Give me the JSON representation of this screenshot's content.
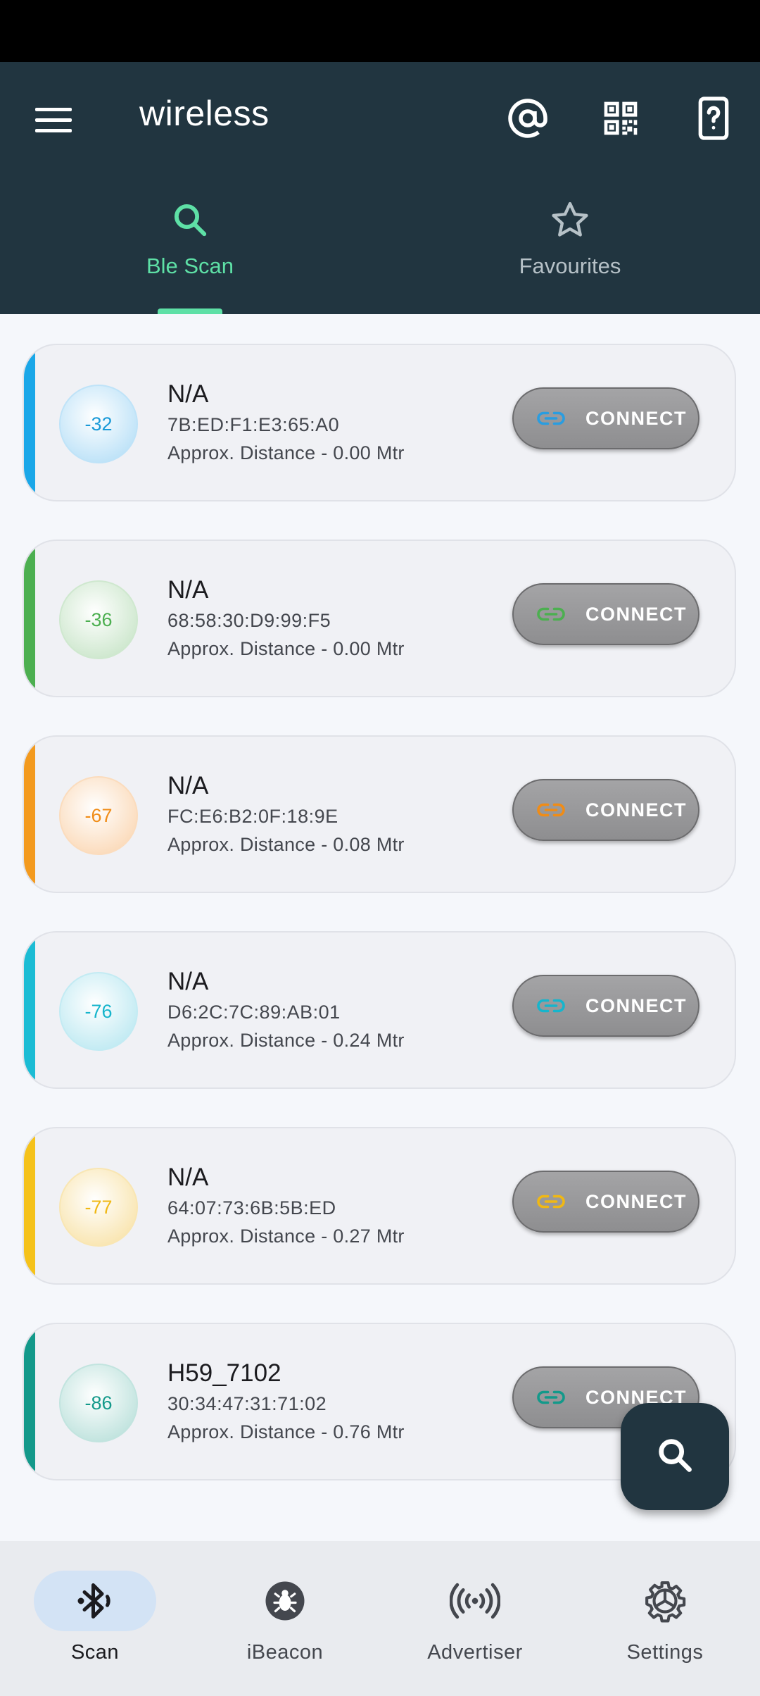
{
  "app_bar": {
    "title": "wireless",
    "menu_icon": "menu-icon",
    "actions": [
      "at-sign-icon",
      "qr-code-icon",
      "device-help-icon"
    ]
  },
  "tabs": [
    {
      "label": "Ble Scan",
      "icon": "search-icon",
      "active": true
    },
    {
      "label": "Favourites",
      "icon": "star-icon",
      "active": false
    }
  ],
  "devices": [
    {
      "rssi": "-32",
      "name": "N/A",
      "mac": "7B:ED:F1:E3:65:A0",
      "distance": "Approx. Distance -  0.00 Mtr",
      "connect_label": "CONNECT",
      "accent": "#1aa7e8",
      "circle_bg": "#bfe3f8",
      "rssi_color": "#1a9ad8",
      "link_color": "#2a9de0"
    },
    {
      "rssi": "-36",
      "name": "N/A",
      "mac": "68:58:30:D9:99:F5",
      "distance": "Approx. Distance -  0.00 Mtr",
      "connect_label": "CONNECT",
      "accent": "#4caf50",
      "circle_bg": "#cfe8cf",
      "rssi_color": "#4caf50",
      "link_color": "#4caf50"
    },
    {
      "rssi": "-67",
      "name": "N/A",
      "mac": "FC:E6:B2:0F:18:9E",
      "distance": "Approx. Distance -  0.08 Mtr",
      "connect_label": "CONNECT",
      "accent": "#f39a1e",
      "circle_bg": "#fbdcbd",
      "rssi_color": "#f08c16",
      "link_color": "#f08c16"
    },
    {
      "rssi": "-76",
      "name": "N/A",
      "mac": "D6:2C:7C:89:AB:01",
      "distance": "Approx. Distance -  0.24 Mtr",
      "connect_label": "CONNECT",
      "accent": "#1bbcd4",
      "circle_bg": "#c3ebf3",
      "rssi_color": "#16b5cc",
      "link_color": "#16b5cc"
    },
    {
      "rssi": "-77",
      "name": "N/A",
      "mac": "64:07:73:6B:5B:ED",
      "distance": "Approx. Distance -  0.27 Mtr",
      "connect_label": "CONNECT",
      "accent": "#f5c21a",
      "circle_bg": "#f9e6b3",
      "rssi_color": "#f0b814",
      "link_color": "#f0b814"
    },
    {
      "rssi": "-86",
      "name": "H59_7102",
      "mac": "30:34:47:31:71:02",
      "distance": "Approx. Distance -  0.76 Mtr",
      "connect_label": "CONNECT",
      "accent": "#13998a",
      "circle_bg": "#c2e4df",
      "rssi_color": "#13998a",
      "link_color": "#13998a"
    }
  ],
  "fab": {
    "icon": "search-icon"
  },
  "bottom_nav": [
    {
      "label": "Scan",
      "icon": "bluetooth-scan-icon",
      "active": true
    },
    {
      "label": "iBeacon",
      "icon": "beacon-bug-icon",
      "active": false
    },
    {
      "label": "Advertiser",
      "icon": "broadcast-icon",
      "active": false
    },
    {
      "label": "Settings",
      "icon": "settings-gear-icon",
      "active": false
    }
  ]
}
